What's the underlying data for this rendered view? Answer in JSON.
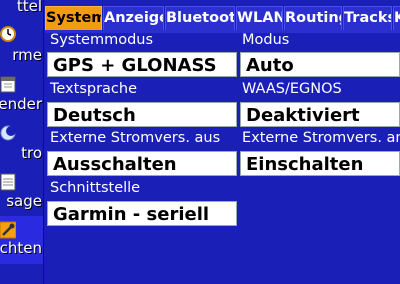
{
  "sidebar": {
    "items": [
      {
        "label": "ttel"
      },
      {
        "label": "rme"
      },
      {
        "label": "ender"
      },
      {
        "label": "tro"
      },
      {
        "label": "sage"
      },
      {
        "label": "chten"
      }
    ]
  },
  "tabs": [
    {
      "label": "System",
      "active": true
    },
    {
      "label": "Anzeige"
    },
    {
      "label": "Bluetooth"
    },
    {
      "label": "WLAN"
    },
    {
      "label": "Routing"
    },
    {
      "label": "Tracks"
    },
    {
      "label": "Ka"
    }
  ],
  "settings": {
    "systemmodus": {
      "label": "Systemmodus",
      "value": "GPS + GLONASS"
    },
    "modus": {
      "label": "Modus",
      "value": "Auto"
    },
    "textsprache": {
      "label": "Textsprache",
      "value": "Deutsch"
    },
    "waas": {
      "label": "WAAS/EGNOS",
      "value": "Deaktiviert"
    },
    "ext_aus": {
      "label": "Externe Stromvers. aus",
      "value": "Ausschalten"
    },
    "ext_an": {
      "label": "Externe Stromvers. an",
      "value": "Einschalten"
    },
    "schnittstelle": {
      "label": "Schnittstelle",
      "value": "Garmin - seriell"
    }
  },
  "colors": {
    "background": "#1a1fb8",
    "tab_active": "#f39c12",
    "tab": "#2b2fd0"
  }
}
